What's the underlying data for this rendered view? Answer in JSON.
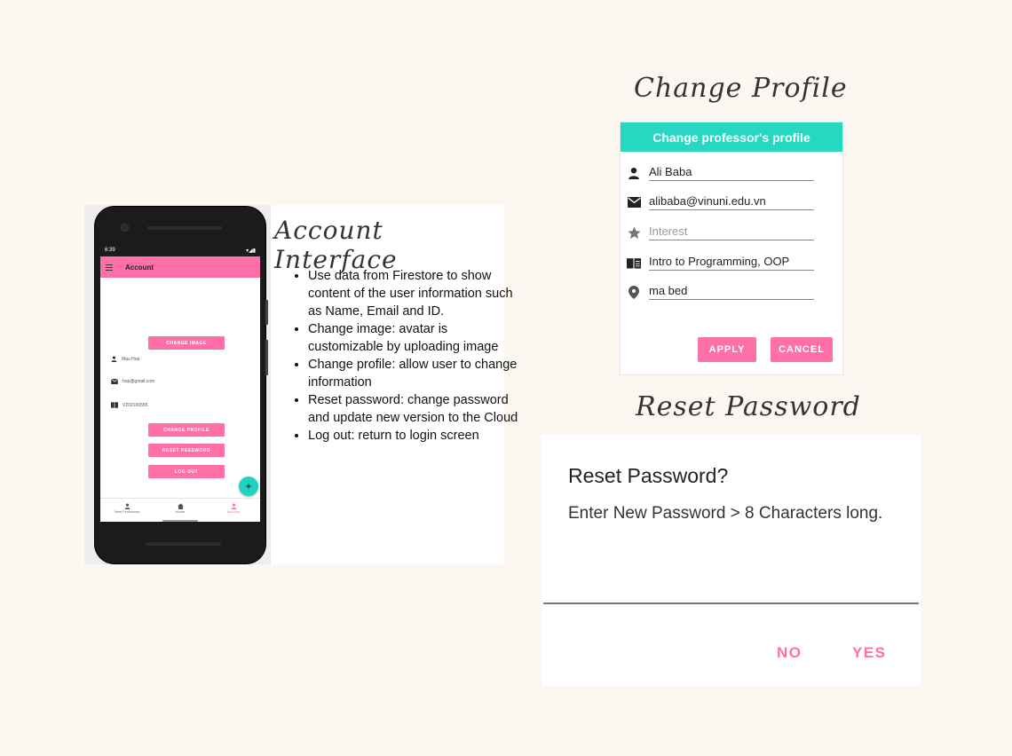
{
  "account_interface": {
    "title": "Account Interface",
    "phone": {
      "status_time": "6:39",
      "app_title": "Account",
      "change_image_label": "CHANGE IMAGE",
      "user_name": "Mau Hop",
      "user_email": "hop@gmail.com",
      "user_id": "V202100555",
      "change_profile_label": "CHANGE PROFILE",
      "reset_password_label": "RESET PASSWORD",
      "log_out_label": "LOG OUT",
      "fab_icon": "plus-icon",
      "nav": [
        {
          "label": "View Professors",
          "icon": "person-icon"
        },
        {
          "label": "Home",
          "icon": "home-icon"
        },
        {
          "label": "Account",
          "icon": "person-icon"
        }
      ],
      "accent_color": "#ff6fa8",
      "fab_color": "#1fd3c0"
    },
    "bullets": [
      "Use data from Firestore to show content of the user information such as Name, Email and ID.",
      "Change image: avatar is customizable by uploading image",
      "Change profile: allow user to change information",
      "Reset password: change password and update new version to the Cloud",
      "Log out: return to login screen"
    ]
  },
  "change_profile": {
    "title": "Change Profile",
    "header": "Change professor's profile",
    "header_color": "#26d8c2",
    "fields": [
      {
        "icon": "person-icon",
        "value": "Ali Baba"
      },
      {
        "icon": "email-icon",
        "value": "alibaba@vinuni.edu.vn"
      },
      {
        "icon": "star-icon",
        "placeholder": "Interest"
      },
      {
        "icon": "book-icon",
        "value": "Intro to Programming, OOP"
      },
      {
        "icon": "location-icon",
        "value": "ma bed"
      }
    ],
    "apply_label": "APPLY",
    "cancel_label": "CANCEL"
  },
  "reset_password": {
    "title": "Reset Password",
    "heading": "Reset Password?",
    "message": "Enter New Password > 8 Characters long.",
    "no_label": "NO",
    "yes_label": "YES"
  }
}
